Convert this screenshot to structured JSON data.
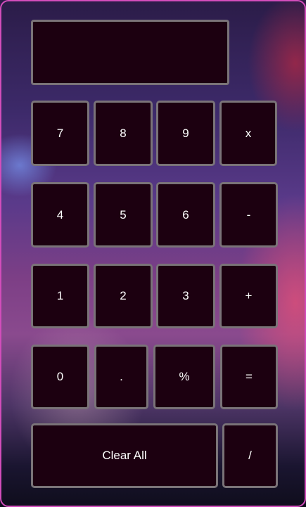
{
  "display": {
    "value": ""
  },
  "keys": {
    "seven": "7",
    "eight": "8",
    "nine": "9",
    "multiply": "x",
    "four": "4",
    "five": "5",
    "six": "6",
    "minus": "-",
    "one": "1",
    "two": "2",
    "three": "3",
    "plus": "+",
    "zero": "0",
    "decimal": ".",
    "percent": "%",
    "equals": "=",
    "clear": "Clear All",
    "divide": "/"
  }
}
